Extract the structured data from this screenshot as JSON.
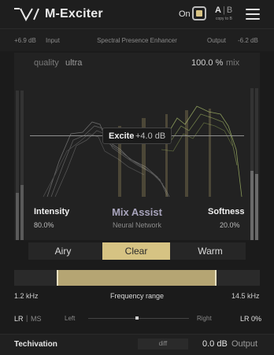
{
  "header": {
    "title": "M-Exciter",
    "on_label": "On",
    "a_label": "A",
    "sep": "|",
    "b_label": "B",
    "copy_label": "copy to B"
  },
  "subbar": {
    "input_value": "+6.9 dB",
    "input_label": "Input",
    "center_title": "Spectral Presence Enhancer",
    "output_label": "Output",
    "output_value": "-6.2 dB"
  },
  "panel": {
    "quality_label": "quality",
    "quality_value": "ultra",
    "mix_value": "100.0 %",
    "mix_label": "mix",
    "excite_label": "Excite",
    "excite_value": "+4.0 dB",
    "intensity_label": "Intensity",
    "intensity_value": "80.0%",
    "assist_title": "Mix Assist",
    "assist_sub": "Neural Network",
    "softness_label": "Softness",
    "softness_value": "20.0%"
  },
  "modes": {
    "items": [
      "Airy",
      "Clear",
      "Warm"
    ],
    "active": "Clear"
  },
  "frequency": {
    "low": "1.2 kHz",
    "title": "Frequency range",
    "high": "14.5 kHz"
  },
  "stereo": {
    "lr": "LR",
    "sep": "|",
    "ms": "MS",
    "left": "Left",
    "right": "Right",
    "value": "LR 0%"
  },
  "footer": {
    "brand": "Techivation",
    "diff": "diff",
    "output_value": "0.0 dB",
    "output_label": "Output"
  },
  "colors": {
    "accent": "#d6c383",
    "background": "#1b1b1b",
    "assist": "#a8a4bc"
  }
}
